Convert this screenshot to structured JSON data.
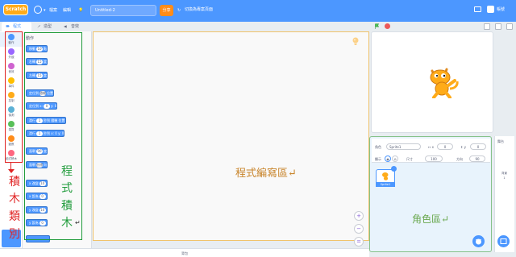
{
  "menubar": {
    "logo": "Scratch",
    "file": "檔案",
    "edit": "編輯",
    "tutorials": "教程",
    "project_title": "Untitled-2",
    "share": "分享",
    "see_project_page": "切換為專案頁面",
    "user": "帳號"
  },
  "tabs": {
    "code": "程式",
    "costumes": "造型",
    "sounds": "音效"
  },
  "categories": [
    {
      "label": "動作",
      "color": "#4c97ff"
    },
    {
      "label": "外觀",
      "color": "#9966ff"
    },
    {
      "label": "音效",
      "color": "#cf63cf"
    },
    {
      "label": "事件",
      "color": "#ffbf00"
    },
    {
      "label": "控制",
      "color": "#ffab19"
    },
    {
      "label": "偵測",
      "color": "#5cb1d6"
    },
    {
      "label": "運算",
      "color": "#59c059"
    },
    {
      "label": "變數",
      "color": "#ff8c1a"
    },
    {
      "label": "函式積木",
      "color": "#ff6680"
    }
  ],
  "palette": {
    "heading": "動作",
    "blocks": [
      {
        "text": "移動",
        "slot": "10",
        "suffix": "點"
      },
      {
        "text": "右轉",
        "slot": "15",
        "suffix": "度"
      },
      {
        "text": "左轉",
        "slot": "15",
        "suffix": "度"
      },
      {
        "text": "定位到",
        "slot": "隨機",
        "suffix": "位置"
      },
      {
        "text": "定位到 x:",
        "slot": "0",
        "suffix": "y: 0"
      },
      {
        "text": "滑行",
        "slot": "1",
        "suffix": "秒到 隨機 位置"
      },
      {
        "text": "滑行",
        "slot": "1",
        "suffix": "秒到 x: 0 y: 0"
      },
      {
        "text": "面朝",
        "slot": "90",
        "suffix": "度"
      },
      {
        "text": "面朝",
        "slot": "鼠標",
        "suffix": "向"
      },
      {
        "text": "x 改變",
        "slot": "10",
        "suffix": ""
      },
      {
        "text": "x 設為",
        "slot": "0",
        "suffix": ""
      },
      {
        "text": "y 改變",
        "slot": "10",
        "suffix": ""
      },
      {
        "text": "y 設為",
        "slot": "0",
        "suffix": ""
      }
    ]
  },
  "annotations": {
    "category_chars": [
      "積",
      "木",
      "類",
      "別"
    ],
    "palette_chars": [
      "程",
      "式",
      "積",
      "木"
    ],
    "script_area": "程式編寫區↵",
    "sprite_area": "角色區↵"
  },
  "sprite_info": {
    "sprite_label": "角色",
    "sprite_name": "Sprite1",
    "x": "0",
    "y": "0",
    "show_label": "顯示",
    "size_label": "尺寸",
    "size": "100",
    "direction_label": "方向",
    "direction": "90"
  },
  "sprite_list": [
    {
      "name": "Sprite1"
    }
  ],
  "stage_pane": {
    "title": "舞台",
    "backdrops_label": "背景",
    "backdrops_count": "1"
  },
  "backpack": "背包"
}
